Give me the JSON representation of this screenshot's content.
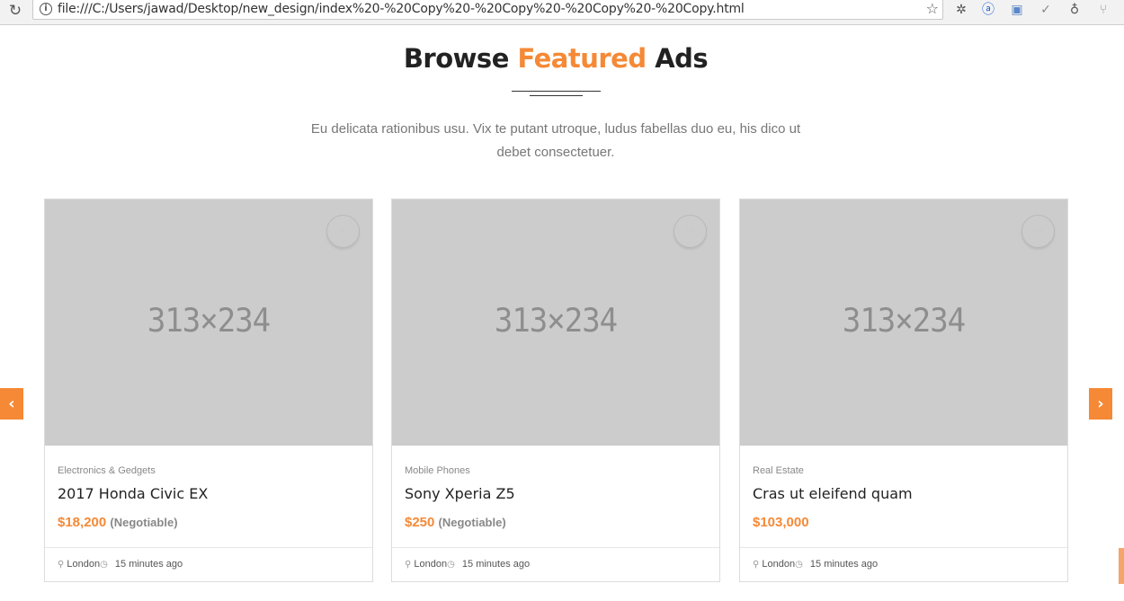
{
  "browser": {
    "url": "file:///C:/Users/jawad/Desktop/new_design/index%20-%20Copy%20-%20Copy%20-%20Copy%20-%20Copy.html",
    "icons": [
      "reload-icon",
      "info-icon",
      "star-icon",
      "extension-bug-icon",
      "extension-a-icon",
      "extension-window-icon",
      "extension-check-icon",
      "extension-cup-icon",
      "extension-branch-icon"
    ]
  },
  "section": {
    "heading_before": "Browse",
    "heading_accent": "Featured",
    "heading_after": "Ads",
    "intro": "Eu delicata rationibus usu. Vix te putant utroque, ludus fabellas duo eu, his dico ut debet consectetuer."
  },
  "colors": {
    "accent": "#f58936",
    "placeholder": "#cccccc"
  },
  "ads": [
    {
      "image_label": "313×234",
      "category": "Electronics & Gedgets",
      "title": "2017 Honda Civic EX",
      "price": "$18,200",
      "price_note": "(Negotiable)",
      "location": "London",
      "time": "15 minutes ago"
    },
    {
      "image_label": "313×234",
      "category": "Mobile Phones",
      "title": "Sony Xperia Z5",
      "price": "$250",
      "price_note": "(Negotiable)",
      "location": "London",
      "time": "15 minutes ago"
    },
    {
      "image_label": "313×234",
      "category": "Real Estate",
      "title": "Cras ut eleifend quam",
      "price": "$103,000",
      "price_note": "",
      "location": "London",
      "time": "15 minutes ago"
    }
  ],
  "carousel": {
    "prev_icon": "chevron-left-icon",
    "next_icon": "chevron-right-icon"
  }
}
